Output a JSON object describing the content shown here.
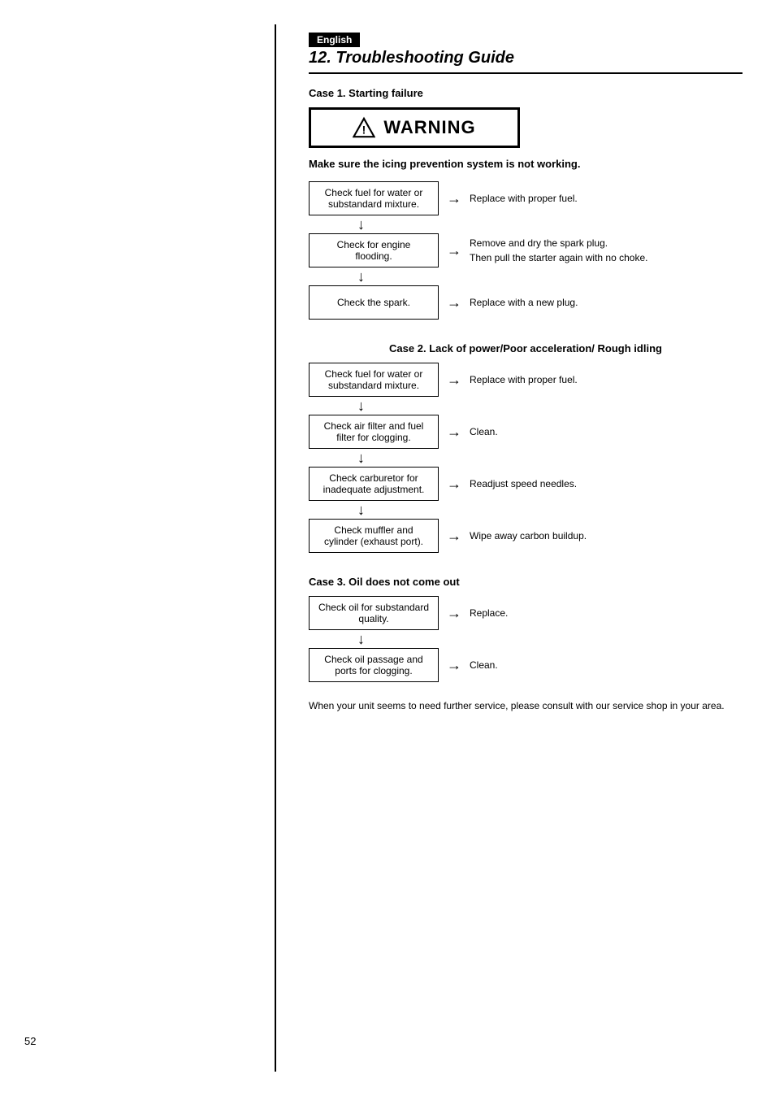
{
  "page": {
    "number": "52",
    "language_badge": "English",
    "chapter": "12. Troubleshooting Guide"
  },
  "warning": {
    "label": "WARNING",
    "description": "Make sure the icing prevention system is not working."
  },
  "case1": {
    "title": "Case 1. Starting failure",
    "steps": [
      {
        "check": "Check fuel for water or substandard mixture.",
        "result": "Replace with proper fuel."
      },
      {
        "check": "Check for engine flooding.",
        "result": "Remove and dry the spark plug.\nThen pull the starter again with no choke."
      },
      {
        "check": "Check the spark.",
        "result": "Replace with a new plug."
      }
    ]
  },
  "case2": {
    "title": "Case 2. Lack of power/Poor acceleration/ Rough idling",
    "steps": [
      {
        "check": "Check fuel for water or substandard mixture.",
        "result": "Replace with proper fuel."
      },
      {
        "check": "Check air filter and fuel filter for clogging.",
        "result": "Clean."
      },
      {
        "check": "Check carburetor for inadequate adjustment.",
        "result": "Readjust speed needles."
      },
      {
        "check": "Check muffler and cylinder (exhaust port).",
        "result": "Wipe away carbon buildup."
      }
    ]
  },
  "case3": {
    "title": "Case 3. Oil does not come out",
    "steps": [
      {
        "check": "Check oil for substandard quality.",
        "result": "Replace."
      },
      {
        "check": "Check oil passage and ports for clogging.",
        "result": "Clean."
      }
    ]
  },
  "footer": {
    "text": "When your unit seems to need further service, please consult with our service shop in your area."
  },
  "icons": {
    "arrow_right": "→",
    "arrow_down": "↓",
    "warning_triangle": "⚠"
  }
}
